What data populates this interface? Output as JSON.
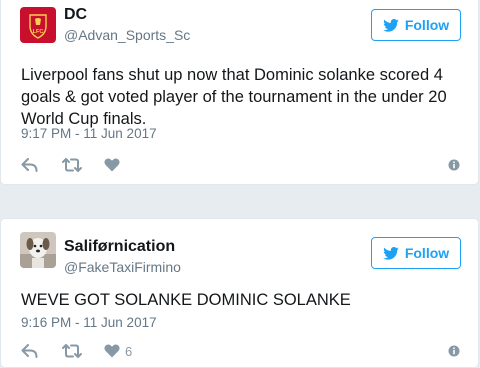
{
  "tweets": [
    {
      "display_name": "DC",
      "handle": "@Advan_Sports_Sc",
      "follow_label": "Follow",
      "text": "Liverpool fans shut up now that Dominic solanke scored 4 goals & got voted player of the tournament in the under 20 World Cup finals.",
      "timestamp": "9:17 PM - 11 Jun 2017",
      "like_count": "",
      "avatar_text": "LFC"
    },
    {
      "display_name": "Saliførnication",
      "handle": "@FakeTaxiFirmino",
      "follow_label": "Follow",
      "text": "WEVE GOT SOLANKE DOMINIC SOLANKE",
      "timestamp": "9:16 PM - 11 Jun 2017",
      "like_count": "6"
    }
  ],
  "colors": {
    "accent": "#1da1f2",
    "muted": "#657786",
    "icon": "#8899a6",
    "lfc_red": "#c8102e",
    "background": "#e6ecf0"
  },
  "icons": [
    "twitter-bird-icon",
    "reply-icon",
    "retweet-icon",
    "heart-icon",
    "info-icon"
  ]
}
